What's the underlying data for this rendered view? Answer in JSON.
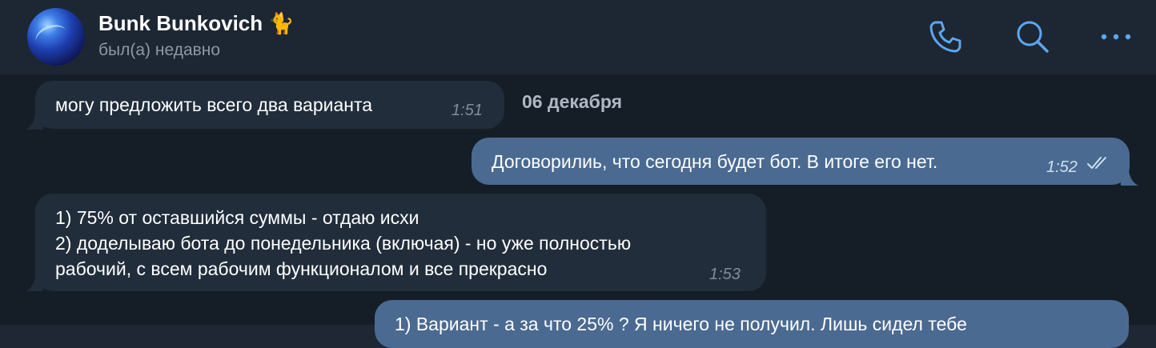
{
  "header": {
    "contact_name": "Bunk Bunkovich 🐈",
    "status": "был(а) недавно",
    "icons": [
      "phone-icon",
      "search-icon",
      "more-icon"
    ]
  },
  "chat": {
    "date_separator": "06 декабря",
    "messages": [
      {
        "direction": "in",
        "text": "могу предложить всего два варианта",
        "time": "1:51"
      },
      {
        "direction": "out",
        "text": "Договорилиь, что сегодня будет бот. В итоге его нет.",
        "time": "1:52"
      },
      {
        "direction": "in",
        "lines": [
          "1) 75% от оставшийся суммы - отдаю исхи",
          "2) доделываю бота до понедельника (включая) - но уже полностью",
          "рабочий, с всем рабочим функционалом и все прекрасно"
        ],
        "time": "1:53"
      },
      {
        "direction": "out",
        "text": "1) Вариант - а за что 25% ? Я ничего не получил. Лишь сидел тебе",
        "time": ""
      }
    ]
  },
  "colors": {
    "header_bg": "#1d2633",
    "chat_bg": "#151e27",
    "incoming_bubble": "#212d3b",
    "outgoing_bubble": "#4a6a91",
    "accent": "#5aa7f1"
  }
}
